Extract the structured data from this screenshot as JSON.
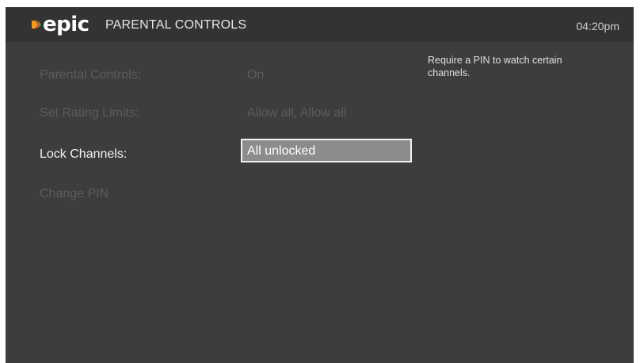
{
  "header": {
    "logo_text": "epic",
    "title": "PARENTAL CONTROLS",
    "time": "04:20pm"
  },
  "settings": {
    "rows": [
      {
        "label": "Parental Controls:",
        "value": "On",
        "active": false
      },
      {
        "label": "Set Rating Limits:",
        "value": "Allow all, Allow all",
        "active": false
      },
      {
        "label": "Lock Channels:",
        "value": "All unlocked",
        "active": true
      },
      {
        "label": "Change PIN",
        "value": "",
        "active": false
      }
    ]
  },
  "help": {
    "text": "Require a PIN to watch certain channels."
  },
  "colors": {
    "background": "#3d3d3d",
    "header": "#333333",
    "selection_fill": "#8c8c8c",
    "selection_border": "#f2f2f2",
    "dim_text": "#5c5c5c",
    "logo_accent_orange": "#f39a1e",
    "logo_accent_red": "#e23b3b",
    "logo_accent_green": "#35b34a"
  },
  "icons": {
    "logo_mark": "epic-logo-mark"
  }
}
